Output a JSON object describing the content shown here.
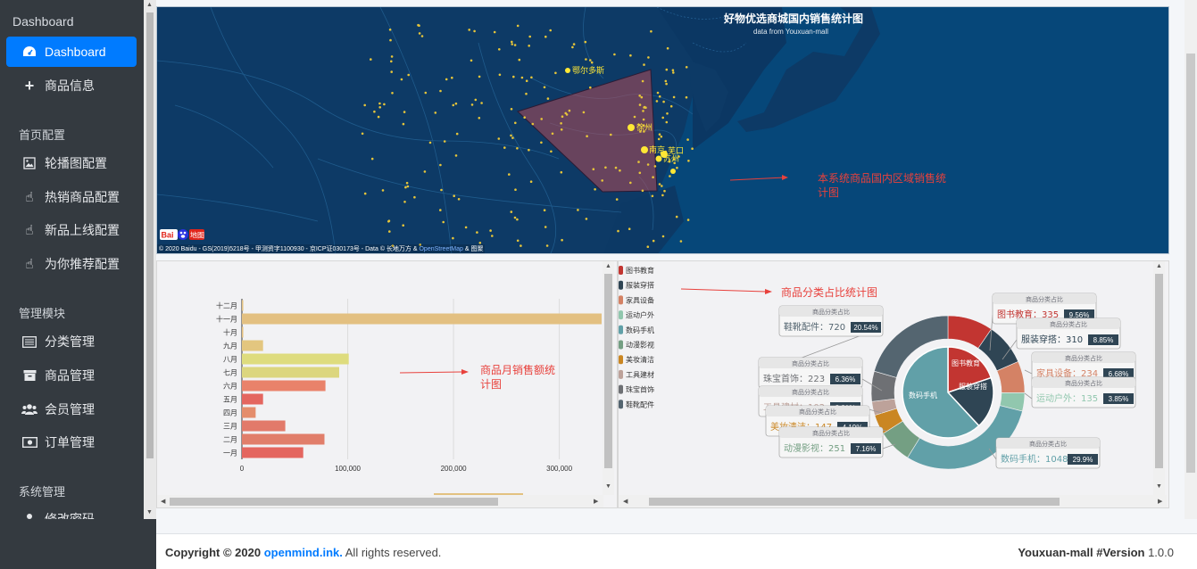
{
  "sidebar": {
    "brand": "Dashboard",
    "items": [
      {
        "label": "Dashboard",
        "icon": "tachometer-icon",
        "active": true
      },
      {
        "label": "商品信息",
        "icon": "plus-icon"
      }
    ],
    "sections": [
      {
        "header": "首页配置",
        "items": [
          {
            "label": "轮播图配置",
            "icon": "image-icon"
          },
          {
            "label": "热销商品配置",
            "icon": "hand-pointer-icon"
          },
          {
            "label": "新品上线配置",
            "icon": "hand-pointer-icon"
          },
          {
            "label": "为你推荐配置",
            "icon": "hand-pointer-icon"
          }
        ]
      },
      {
        "header": "管理模块",
        "items": [
          {
            "label": "分类管理",
            "icon": "list-icon"
          },
          {
            "label": "商品管理",
            "icon": "archive-icon"
          },
          {
            "label": "会员管理",
            "icon": "users-icon"
          },
          {
            "label": "订单管理",
            "icon": "money-icon"
          }
        ]
      },
      {
        "header": "系统管理",
        "items": [
          {
            "label": "修改密码",
            "icon": "user-icon"
          }
        ]
      }
    ]
  },
  "map": {
    "title": "好物优选商城国内销售统计图",
    "subtitle": "data from Youxuan-mall",
    "annotation": "本系统商品国内区域销售统计图",
    "copyright": "© 2020 Baidu - GS(2019)5218号 - 甲测资字1100930 - 京ICP证030173号 - Data © 长地万方 & ",
    "copyright_link": "OpenStreetMap",
    "copyright_tail": " & 图聚",
    "cities": [
      "鄂尔多斯",
      "徐州",
      "南京",
      "芜口",
      "苏州"
    ],
    "logo": "Baidu 地图"
  },
  "bar_chart_annotation": "商品月销售额统计图",
  "pie_chart_annotation": "商品分类占比统计图",
  "chart_data": [
    {
      "type": "bar",
      "orientation": "horizontal",
      "categories": [
        "一月",
        "二月",
        "三月",
        "四月",
        "五月",
        "六月",
        "七月",
        "八月",
        "九月",
        "十月",
        "十一月",
        "十二月"
      ],
      "values": [
        58000,
        78000,
        41000,
        13000,
        20000,
        79000,
        92000,
        101000,
        20000,
        1000,
        340000,
        1000
      ],
      "xlim": [
        0,
        340000
      ],
      "xticks": [
        "0",
        "100,000",
        "200,000",
        "300,000"
      ],
      "colors": [
        "#e4665f",
        "#e17e6a",
        "#e27a6a",
        "#e48d6c",
        "#e4665f",
        "#e9826a",
        "#dcd67e",
        "#dedc7e",
        "#e3c67f",
        "#e4bf7c",
        "#e3c081",
        "#e3c180"
      ],
      "grid": true
    },
    {
      "type": "pie",
      "title": "商品分类占比",
      "legend": [
        "图书教育",
        "服装穿搭",
        "家具设备",
        "运动户外",
        "数码手机",
        "动漫影视",
        "美妆清洁",
        "工具建材",
        "珠宝首饰",
        "鞋靴配件"
      ],
      "values": [
        335,
        310,
        234,
        135,
        1048,
        251,
        147,
        102,
        223,
        720
      ],
      "percents": [
        "9.56%",
        "8.85%",
        "6.68%",
        "3.85%",
        "29.9%",
        "7.16%",
        "4.19%",
        "2.91%",
        "6.36%",
        "20.54%"
      ],
      "colors": [
        "#c23531",
        "#2f4554",
        "#d48265",
        "#91c7ae",
        "#61a0a8",
        "#749f83",
        "#ca8622",
        "#bda29a",
        "#6e7074",
        "#546570"
      ],
      "inner_labels": [
        "图书教育",
        "服装穿搭",
        "数码手机"
      ],
      "tooltip_title": "商品分类占比",
      "legend_position": "left"
    }
  ],
  "footer": {
    "copyright_prefix": "Copyright © 2020",
    "site": "openmind.ink.",
    "rights": "All rights reserved.",
    "app": "Youxuan-mall",
    "version_label": "#Version",
    "version": "1.0.0"
  }
}
